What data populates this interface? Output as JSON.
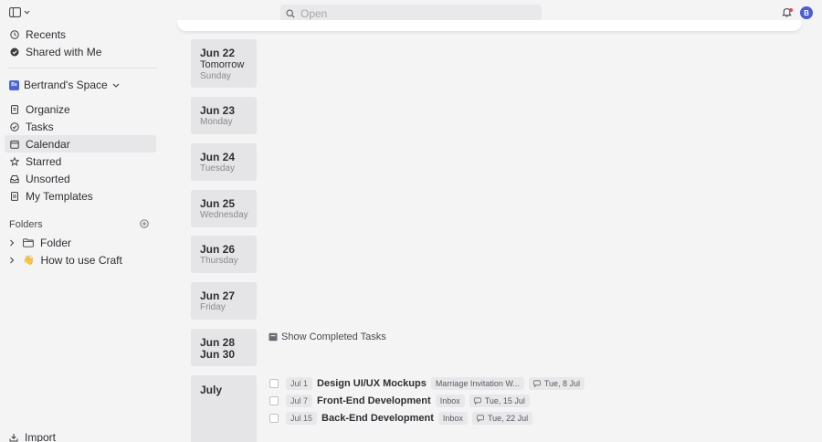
{
  "sidebar": {
    "nav": [
      {
        "label": "Recents",
        "icon": "clock-icon"
      },
      {
        "label": "Shared with Me",
        "icon": "shared-icon"
      }
    ],
    "space": {
      "badge": "Bs",
      "label": "Bertrand's Space"
    },
    "items": [
      {
        "label": "Organize",
        "icon": "document-icon"
      },
      {
        "label": "Tasks",
        "icon": "check-circle-icon"
      },
      {
        "label": "Calendar",
        "icon": "calendar-icon",
        "active": true
      },
      {
        "label": "Starred",
        "icon": "star-icon"
      },
      {
        "label": "Unsorted",
        "icon": "tray-icon"
      },
      {
        "label": "My Templates",
        "icon": "template-icon"
      }
    ],
    "folders_label": "Folders",
    "folders": [
      {
        "label": "Folder",
        "icon": "folder-icon"
      },
      {
        "label": "How to use Craft",
        "icon": "wave-emoji-icon",
        "emoji": "👋"
      }
    ],
    "import_label": "Import"
  },
  "search": {
    "placeholder": "Open"
  },
  "user": {
    "avatar_initial": "B"
  },
  "days": [
    {
      "date": "Jun 22",
      "sub": "Tomorrow",
      "sub2": "Sunday"
    },
    {
      "date": "Jun 23",
      "sub": "Monday"
    },
    {
      "date": "Jun 24",
      "sub": "Tuesday"
    },
    {
      "date": "Jun 25",
      "sub": "Wednesday"
    },
    {
      "date": "Jun 26",
      "sub": "Thursday"
    },
    {
      "date": "Jun 27",
      "sub": "Friday"
    },
    {
      "date": "Jun 28",
      "sub": "Jun 30"
    },
    {
      "date": "July"
    }
  ],
  "completed": {
    "label": "Show Completed Tasks",
    "tasks": [
      {
        "date": "Jul 1",
        "title": "Design UI/UX Mockups",
        "location": "Marriage Invitation W...",
        "due": "Tue, 8 Jul"
      },
      {
        "date": "Jul 7",
        "title": "Front-End Development",
        "location": "Inbox",
        "due": "Tue, 15 Jul"
      },
      {
        "date": "Jul 15",
        "title": "Back-End Development",
        "location": "Inbox",
        "due": "Tue, 22 Jul"
      }
    ]
  },
  "colors": {
    "accent": "#4a5fd6",
    "background": "#f4f4f5",
    "card": "#e5e5e7",
    "notification": "#e5484d"
  }
}
